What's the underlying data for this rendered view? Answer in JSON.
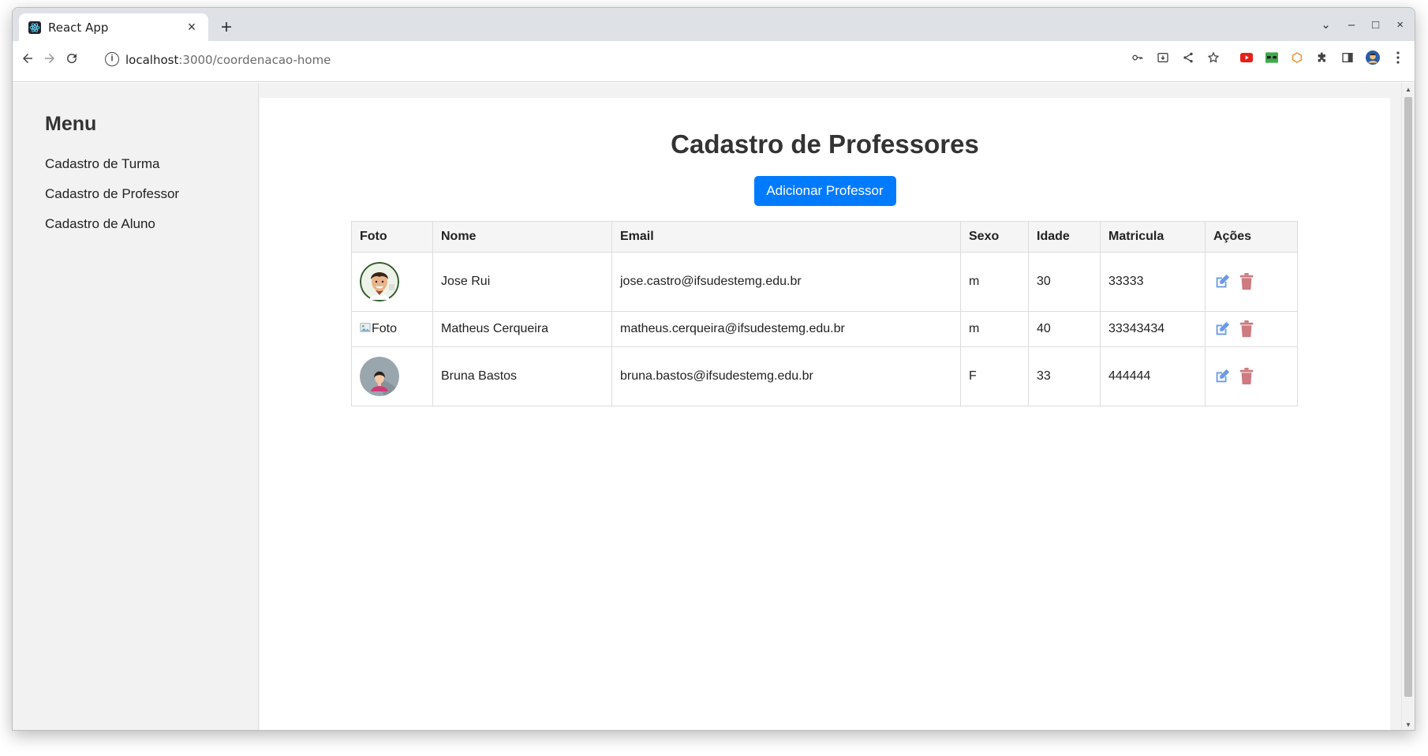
{
  "browser": {
    "tab_title": "React App",
    "tab_close": "×",
    "new_tab": "+",
    "url_host": "localhost",
    "url_path": ":3000/coordenacao-home",
    "window_controls": [
      "⌄",
      "–",
      "□",
      "×"
    ]
  },
  "sidebar": {
    "title": "Menu",
    "items": [
      "Cadastro de Turma",
      "Cadastro de Professor",
      "Cadastro de Aluno"
    ]
  },
  "main": {
    "title": "Cadastro de Professores",
    "add_button": "Adicionar Professor",
    "columns": [
      "Foto",
      "Nome",
      "Email",
      "Sexo",
      "Idade",
      "Matricula",
      "Ações"
    ],
    "rows": [
      {
        "foto": "avatar-male",
        "nome": "Jose Rui",
        "email": "jose.castro@ifsudestemg.edu.br",
        "sexo": "m",
        "idade": "30",
        "matricula": "33333"
      },
      {
        "foto": "Foto",
        "nome": "Matheus Cerqueira",
        "email": "matheus.cerqueira@ifsudestemg.edu.br",
        "sexo": "m",
        "idade": "40",
        "matricula": "33343434"
      },
      {
        "foto": "avatar-female",
        "nome": "Bruna Bastos",
        "email": "bruna.bastos@ifsudestemg.edu.br",
        "sexo": "F",
        "idade": "33",
        "matricula": "444444"
      }
    ]
  },
  "colors": {
    "primary": "#007bff",
    "edit": "#6b9be6",
    "delete": "#cd7a80"
  }
}
